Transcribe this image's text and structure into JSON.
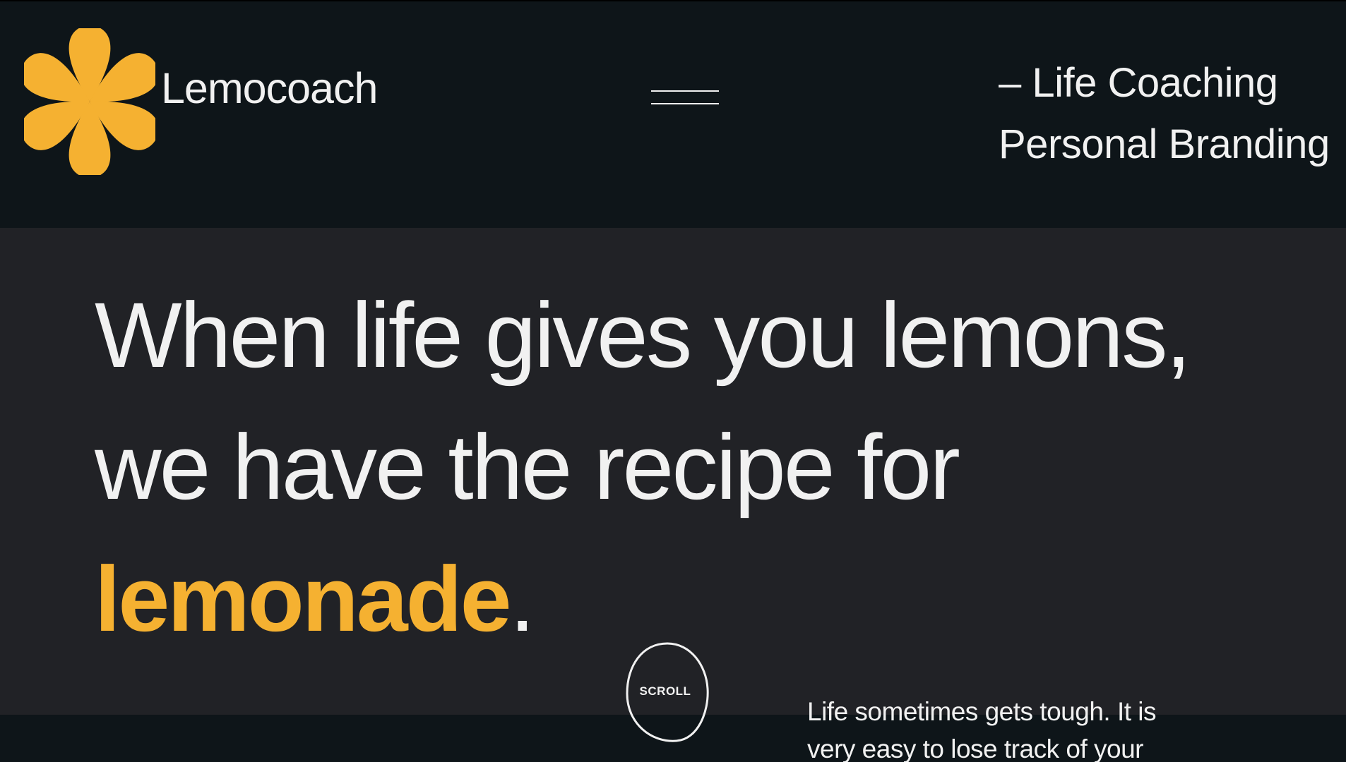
{
  "brand": {
    "name": "Lemocoach",
    "icon": "lemon-flower-icon",
    "accent_color": "#f5b131"
  },
  "header": {
    "menu_icon": "hamburger-menu-icon",
    "services": [
      "– Life Coaching",
      "Personal Branding"
    ]
  },
  "hero": {
    "line1": "When life gives you lemons,",
    "line2": "we have the recipe for",
    "highlight": "lemonade",
    "punctuation": "."
  },
  "scroll": {
    "label": "SCROLL",
    "icon": "scroll-circle-icon"
  },
  "intro": {
    "text": "Life sometimes gets tough. It is very easy to lose track of your"
  },
  "colors": {
    "background_dark": "#0e1519",
    "hero_background": "#212226",
    "text": "#f1f1f1",
    "accent": "#f5b131"
  }
}
